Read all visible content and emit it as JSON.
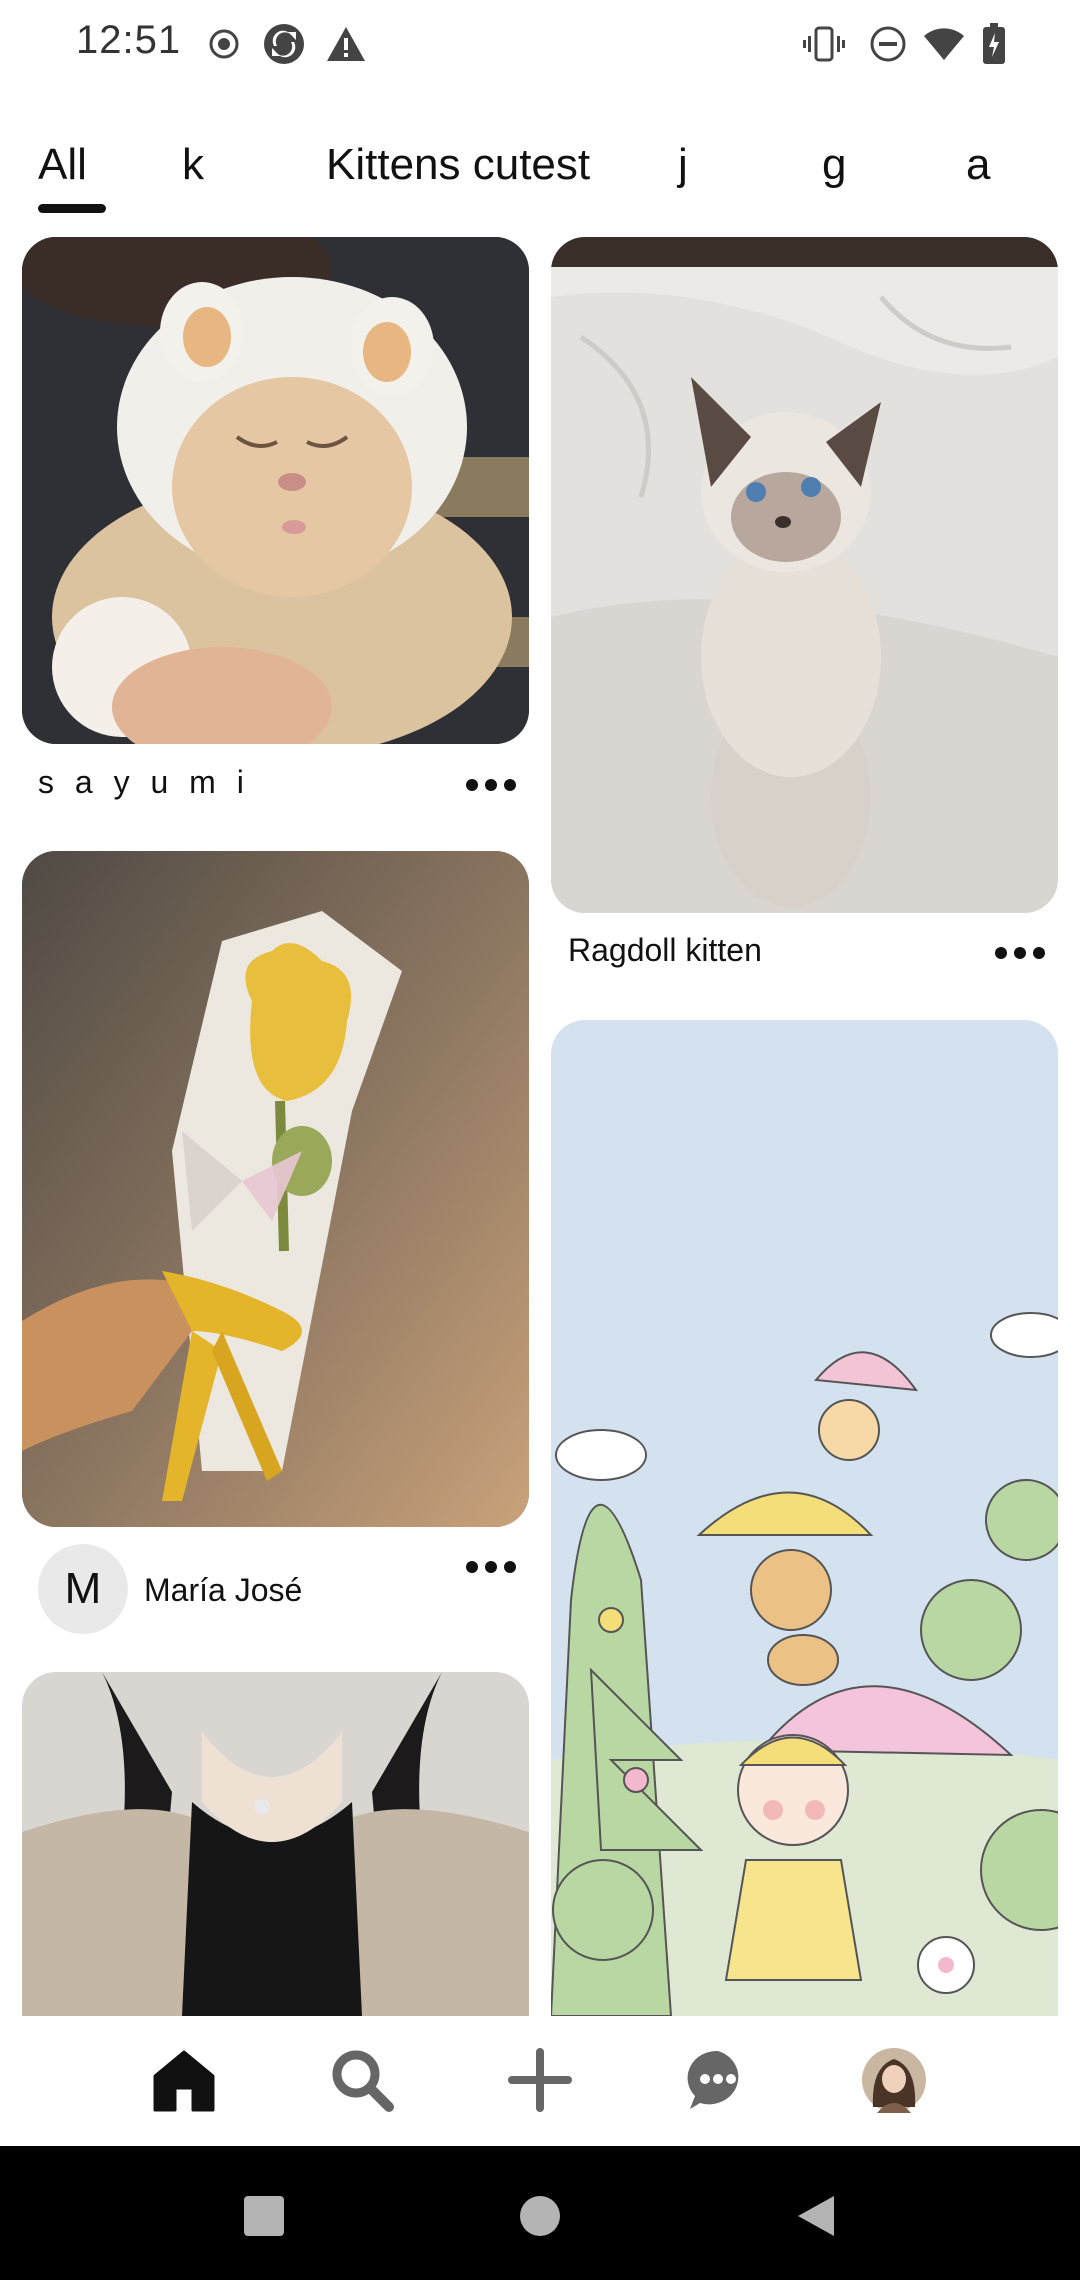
{
  "status_bar": {
    "time": "12:51",
    "left_icons": [
      "record-icon",
      "sync-icon",
      "warning-icon"
    ],
    "right_icons": [
      "vibrate-icon",
      "do-not-disturb-icon",
      "wifi-icon",
      "battery-icon"
    ]
  },
  "tabs": [
    {
      "label": "All",
      "selected": true
    },
    {
      "label": "k"
    },
    {
      "label": "Kittens cutest"
    },
    {
      "label": "j"
    },
    {
      "label": "g"
    },
    {
      "label": "a"
    }
  ],
  "pins": {
    "left": [
      {
        "title": "s a y u m i",
        "image": "kitten-in-bear-hat"
      },
      {
        "title": "María José",
        "avatar_letter": "M",
        "image": "crochet-tulip-bouquet"
      },
      {
        "image": "girl-in-beige-cardigan"
      }
    ],
    "right": [
      {
        "title": "Ragdoll kitten",
        "image": "ragdoll-kitten-on-bed"
      },
      {
        "image": "cute-rainy-illustration"
      }
    ]
  },
  "bottom_nav": [
    "home-icon",
    "search-icon",
    "create-icon",
    "messages-icon",
    "profile-avatar"
  ],
  "colors": {
    "text": "#111111",
    "bg": "#ffffff",
    "sysnav": "#000000"
  }
}
